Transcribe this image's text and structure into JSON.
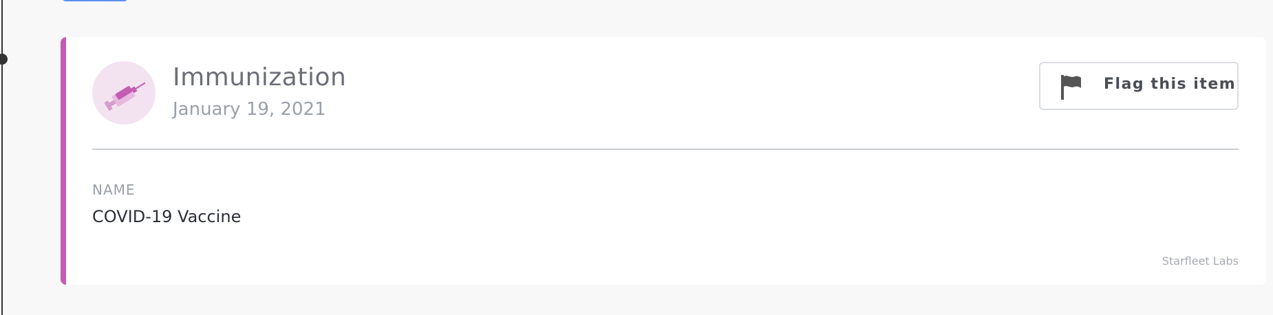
{
  "card": {
    "title": "Immunization",
    "date": "January 19, 2021",
    "icon": "syringe-icon",
    "accent_color": "#c45cb3",
    "flag_button_label": "Flag this item",
    "flag_button_icon": "flag-icon",
    "fields": [
      {
        "label": "NAME",
        "value": "COVID-19 Vaccine"
      }
    ],
    "footer": "Starfleet Labs"
  }
}
